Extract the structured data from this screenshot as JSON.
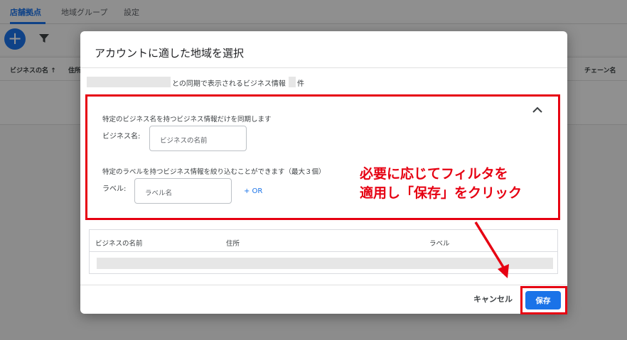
{
  "background": {
    "tabs": [
      {
        "label": "店舗拠点",
        "active": true
      },
      {
        "label": "地域グループ",
        "active": false
      },
      {
        "label": "設定",
        "active": false
      }
    ],
    "add_button_glyph": "+",
    "filter_icon": "filter-icon",
    "columns": {
      "business_name": "ビジネスの名 ↑",
      "address_short": "住所",
      "chain_name": "チェーン名"
    }
  },
  "dialog": {
    "title": "アカウントに適した地域を選択",
    "sync_text": "との同期で表示されるビジネス情報",
    "sync_unit": "件",
    "filter": {
      "name_desc": "特定のビジネス名を持つビジネス情報だけを同期します",
      "name_label": "ビジネス名:",
      "name_placeholder": "ビジネスの名前",
      "label_desc": "特定のラベルを持つビジネス情報を絞り込むことができます（最大３個）",
      "label_label": "ラベル:",
      "label_placeholder": "ラベル名",
      "or_link": "+ OR",
      "collapse_icon": "chevron-up-icon"
    },
    "table": {
      "headers": [
        "ビジネスの名前",
        "住所",
        "ラベル"
      ]
    },
    "buttons": {
      "cancel": "キャンセル",
      "save": "保存"
    }
  },
  "annotation": {
    "line1": "必要に応じてフィルタを",
    "line2": "適用し「保存」をクリック"
  },
  "colors": {
    "accent": "#1a73e8",
    "annotation_red": "#e60012"
  }
}
